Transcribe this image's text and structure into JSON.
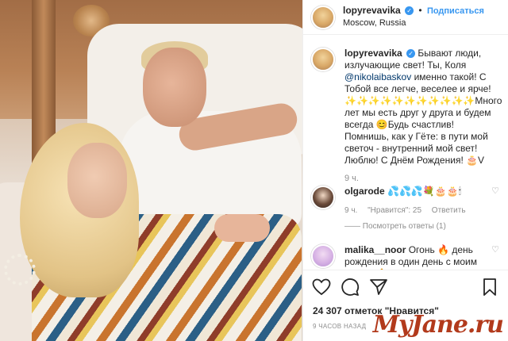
{
  "post": {
    "username": "lopyrevavika",
    "follow_label": "Подписаться",
    "separator": "•",
    "location": "Moscow, Russia"
  },
  "caption": {
    "username": "lopyrevavika",
    "text_before_mention": "Бывают люди, излучающие свет! Ты, Коля ",
    "mention": "@nikolaibaskov",
    "text_after_mention": " именно такой! С Тобой все легче, веселее и ярче! ✨✨✨✨✨✨✨✨✨✨✨Много лет мы есть друг у друга и будем всегда 😊Будь счастлив! Помнишь, как у Гёте: в пути мой светоч - внутренний мой свет! Люблю! С Днём Рождения! 🎂V",
    "time": "9 ч."
  },
  "comments": [
    {
      "username": "olgarode",
      "text": "💦💦💦💐🎂🎂🕯",
      "time": "9 ч.",
      "likes_label": "\"Нравится\": 25",
      "reply_label": "Ответить",
      "replies_label": "—— Посмотреть ответы (1)"
    },
    {
      "username": "malika__noor",
      "text": "Огонь 🔥 день рождения в один день с моим сыном 🙏",
      "time": ""
    }
  ],
  "actions": {
    "like_icon": "heart-outline-icon",
    "comment_icon": "comment-bubble-icon",
    "share_icon": "paper-plane-icon",
    "save_icon": "bookmark-icon",
    "likes_count": "24 307 отметок \"Нравится\"",
    "posted_ago": "9 ЧАСОВ НАЗАД"
  },
  "watermark": "MyJane.ru",
  "colors": {
    "link_blue": "#3897f0",
    "mention_blue": "#00376b",
    "secondary_text": "#8e8e8e",
    "watermark_red": "#b23a1c"
  }
}
